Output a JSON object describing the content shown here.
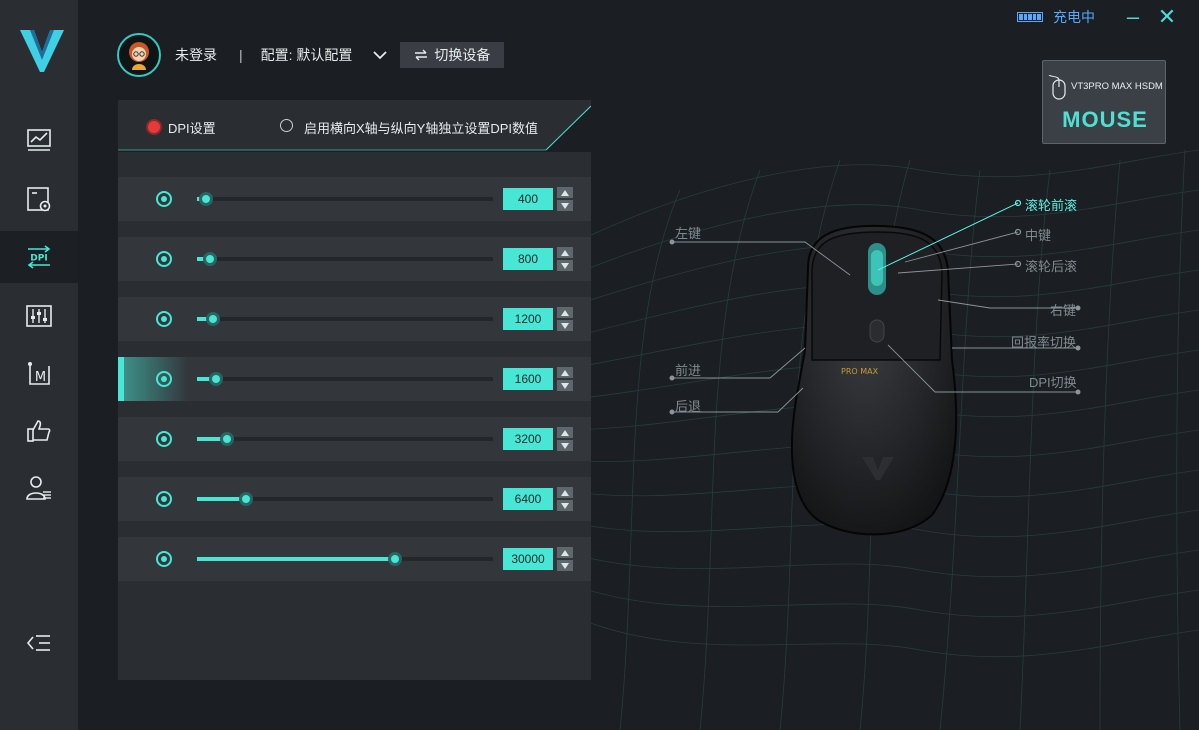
{
  "window": {
    "charge_status": "充电中",
    "minimize_label": "–",
    "close_label": "✕"
  },
  "sidebar": {
    "items": [
      {
        "name": "performance",
        "icon": "chart-monitor-icon"
      },
      {
        "name": "settings",
        "icon": "screen-gear-icon"
      },
      {
        "name": "dpi",
        "icon": "dpi-icon",
        "label": "DPI",
        "active": true
      },
      {
        "name": "equalizer",
        "icon": "sliders-icon"
      },
      {
        "name": "macro",
        "icon": "macro-icon",
        "label": "M"
      },
      {
        "name": "recommend",
        "icon": "thumbs-up-icon"
      },
      {
        "name": "account",
        "icon": "user-list-icon"
      }
    ],
    "collapse_icon": "collapse-menu-icon"
  },
  "user": {
    "name": "未登录",
    "separator": "|",
    "config_label": "配置: 默认配置",
    "switch_device_label": "切换设备"
  },
  "device": {
    "model": "VT3PRO MAX HSDM",
    "type": "MOUSE"
  },
  "dpi_panel": {
    "mode_dpi_label": "DPI设置",
    "mode_xy_label": "启用横向X轴与纵向Y轴独立设置DPI数值",
    "max_dpi": 30000,
    "active_index": 3,
    "levels": [
      {
        "value": "400",
        "slider_fraction": 0.03
      },
      {
        "value": "800",
        "slider_fraction": 0.045
      },
      {
        "value": "1200",
        "slider_fraction": 0.055
      },
      {
        "value": "1600",
        "slider_fraction": 0.065
      },
      {
        "value": "3200",
        "slider_fraction": 0.1
      },
      {
        "value": "6400",
        "slider_fraction": 0.165
      },
      {
        "value": "30000",
        "slider_fraction": 0.67
      }
    ]
  },
  "mouse_buttons": {
    "left": "左键",
    "scroll_up": "滚轮前滚",
    "middle": "中键",
    "scroll_down": "滚轮后滚",
    "right": "右键",
    "polling_switch": "回报率切换",
    "dpi_switch": "DPI切换",
    "forward": "前进",
    "back": "后退",
    "model_print": "PRO MAX"
  },
  "colors": {
    "accent": "#47e6d5",
    "active_mode": "#e63a3a",
    "battery": "#56a9ff"
  }
}
